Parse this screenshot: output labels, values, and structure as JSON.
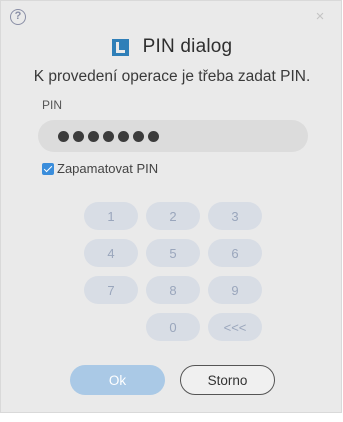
{
  "header": {
    "help_icon": "?",
    "close_icon": "×",
    "logo_icon": "app-logo",
    "title": "PIN dialog"
  },
  "message": "K provedení operace je třeba zadat PIN.",
  "pin": {
    "label": "PIN",
    "masked_length": 7
  },
  "remember": {
    "label": "Zapamatovat PIN",
    "checked": true
  },
  "keypad": {
    "k1": "1",
    "k2": "2",
    "k3": "3",
    "k4": "4",
    "k5": "5",
    "k6": "6",
    "k7": "7",
    "k8": "8",
    "k9": "9",
    "k0": "0",
    "backspace": "<<<"
  },
  "buttons": {
    "ok": "Ok",
    "cancel": "Storno"
  },
  "colors": {
    "accent": "#2f7fb8",
    "checkbox": "#3a8ddb",
    "ok_button": "#aac9e6",
    "key_background": "#d8dde5"
  }
}
